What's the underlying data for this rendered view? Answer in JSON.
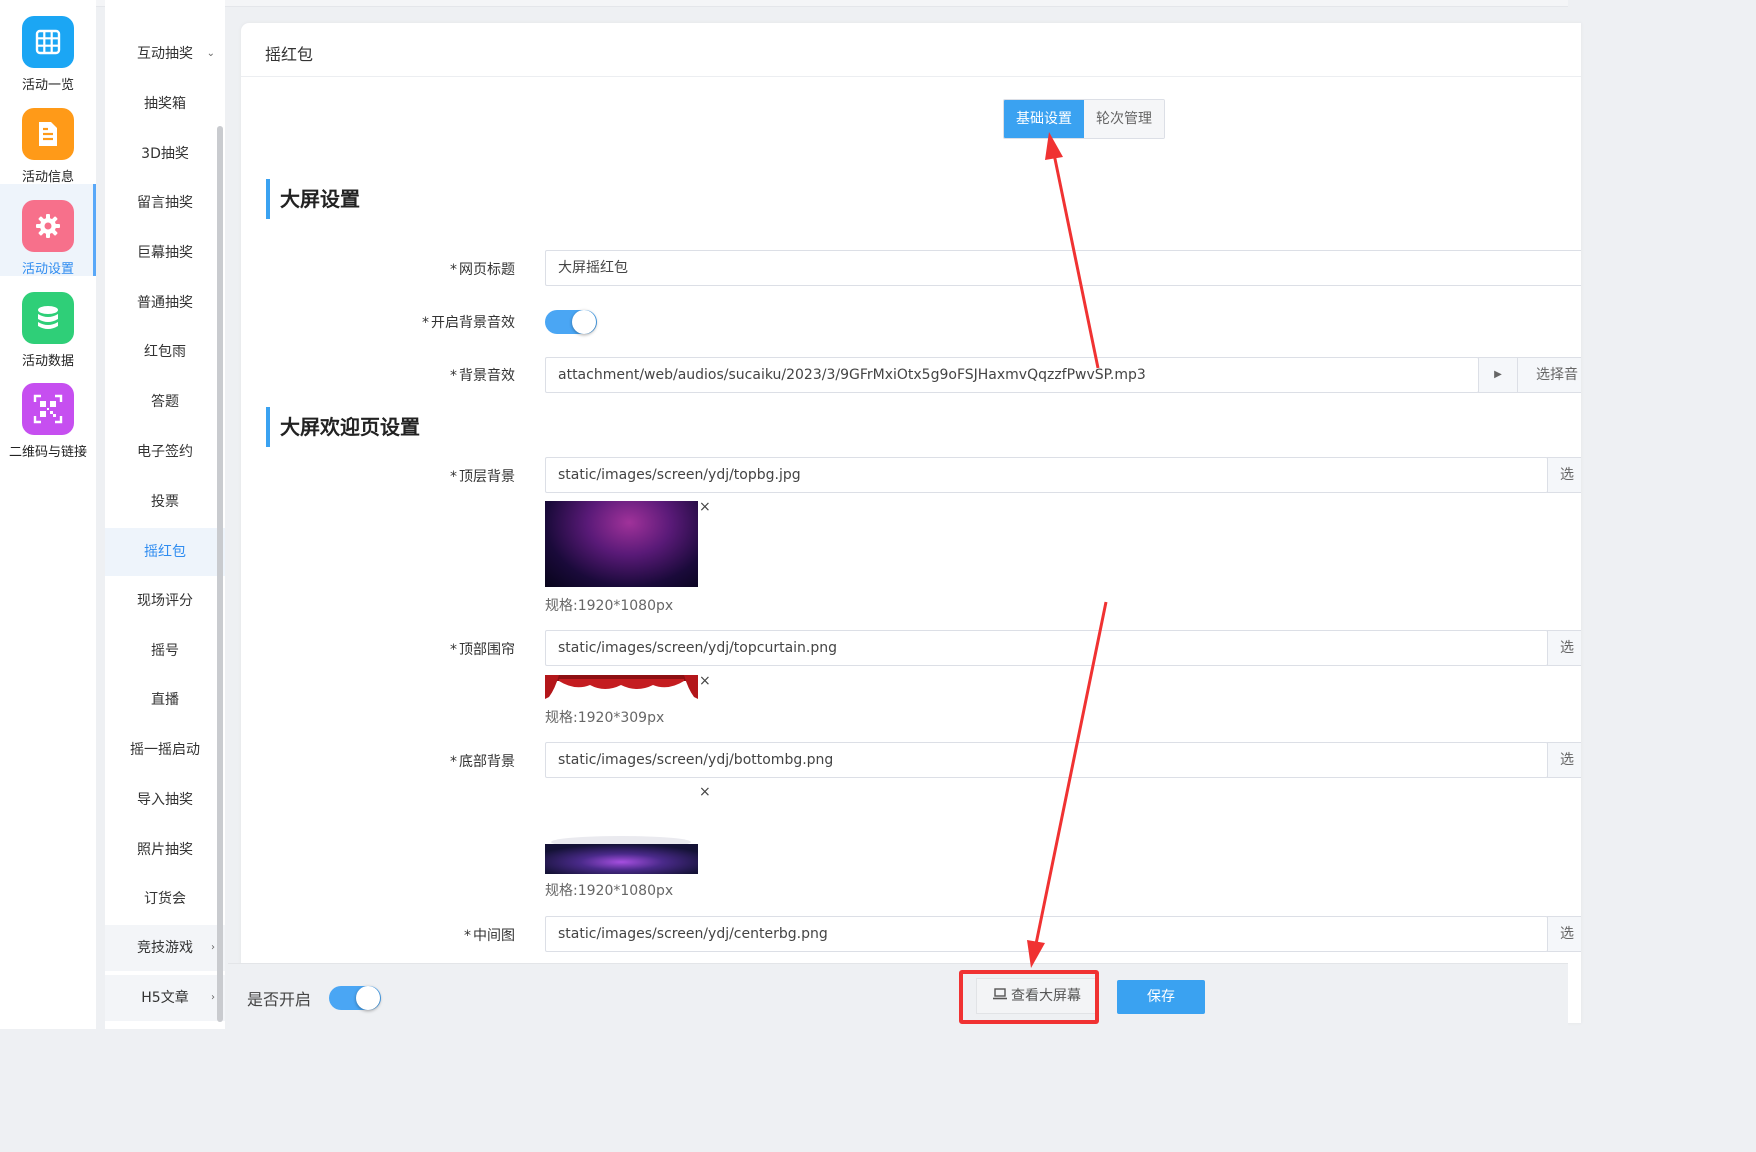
{
  "rail": [
    {
      "label": "活动一览",
      "icon": "grid-icon",
      "color": "#1ba6f4"
    },
    {
      "label": "活动信息",
      "icon": "document-icon",
      "color": "#ff9a18"
    },
    {
      "label": "活动设置",
      "icon": "gear-icon",
      "color": "#f7708b"
    },
    {
      "label": "活动数据",
      "icon": "database-icon",
      "color": "#2fcf78"
    },
    {
      "label": "二维码与链接",
      "icon": "qrcode-icon",
      "color": "#c64ff0"
    }
  ],
  "submenu": {
    "peek": "活动设置",
    "group_lottery": "互动抽奖",
    "items": [
      "抽奖箱",
      "3D抽奖",
      "留言抽奖",
      "巨幕抽奖",
      "普通抽奖",
      "红包雨",
      "答题",
      "电子签约",
      "投票",
      "摇红包",
      "现场评分",
      "摇号",
      "直播",
      "摇一摇启动",
      "导入抽奖",
      "照片抽奖",
      "订货会"
    ],
    "group_games": "竞技游戏",
    "group_h5": "H5文章"
  },
  "page": {
    "title": "摇红包",
    "tabs": [
      "基础设置",
      "轮次管理"
    ]
  },
  "sections": {
    "screen": "大屏设置",
    "welcome": "大屏欢迎页设置"
  },
  "form": {
    "page_title_label": "网页标题",
    "page_title_value": "大屏摇红包",
    "bg_sound_toggle_label": "开启背景音效",
    "bg_sound_label": "背景音效",
    "bg_sound_value": "attachment/web/audios/sucaiku/2023/3/9GFrMxiOtx5g9oFSJHaxmvQqzzfPwvSP.mp3",
    "bg_sound_play": "▶",
    "bg_sound_choose": "选择音",
    "top_bg_label": "顶层背景",
    "top_bg_value": "static/images/screen/ydj/topbg.jpg",
    "top_bg_spec": "规格:1920*1080px",
    "top_curtain_label": "顶部围帘",
    "top_curtain_value": "static/images/screen/ydj/topcurtain.png",
    "top_curtain_spec": "规格:1920*309px",
    "bottom_bg_label": "底部背景",
    "bottom_bg_value": "static/images/screen/ydj/bottombg.png",
    "bottom_bg_spec": "规格:1920*1080px",
    "center_label": "中间图",
    "center_value": "static/images/screen/ydj/centerbg.png",
    "choose_clip": "选",
    "remove": "×",
    "required_mark": "*"
  },
  "bottombar": {
    "enable_label": "是否开启",
    "view_screen": "查看大屏幕",
    "save": "保存"
  },
  "toggles": {
    "bg_sound_on": true,
    "enabled_on": true
  },
  "colors": {
    "accent": "#3aa2f1",
    "annotation": "#f03232"
  }
}
